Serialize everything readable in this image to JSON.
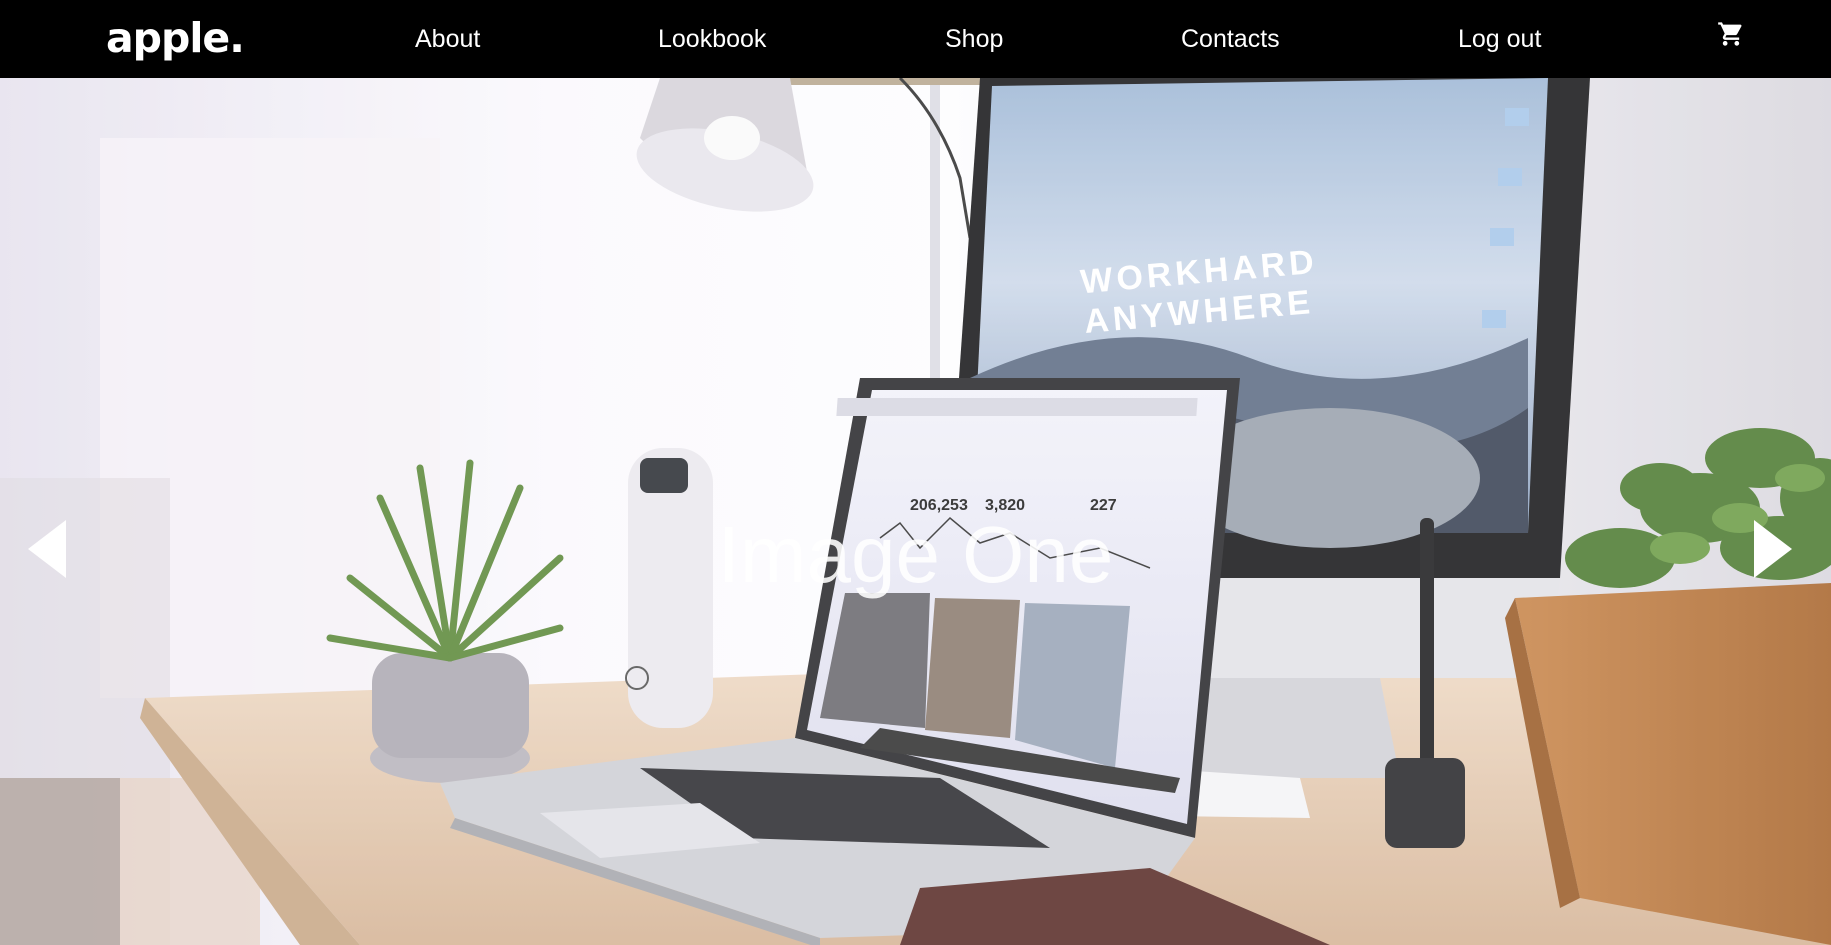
{
  "brand": {
    "logo_text": "apple."
  },
  "nav": {
    "items": [
      {
        "label": "About"
      },
      {
        "label": "Lookbook"
      },
      {
        "label": "Shop"
      },
      {
        "label": "Contacts"
      },
      {
        "label": "Log out"
      }
    ],
    "cart_icon": "shopping-cart-icon"
  },
  "hero": {
    "caption": "Image One",
    "monitor_text_line1": "WORKHARD",
    "monitor_text_line2": "ANYWHERE",
    "laptop_stats": [
      "206,253",
      "3,820",
      "227"
    ],
    "prev_icon": "triangle-left-icon",
    "next_icon": "triangle-right-icon"
  },
  "colors": {
    "header_bg": "#000000",
    "header_text": "#ffffff"
  }
}
